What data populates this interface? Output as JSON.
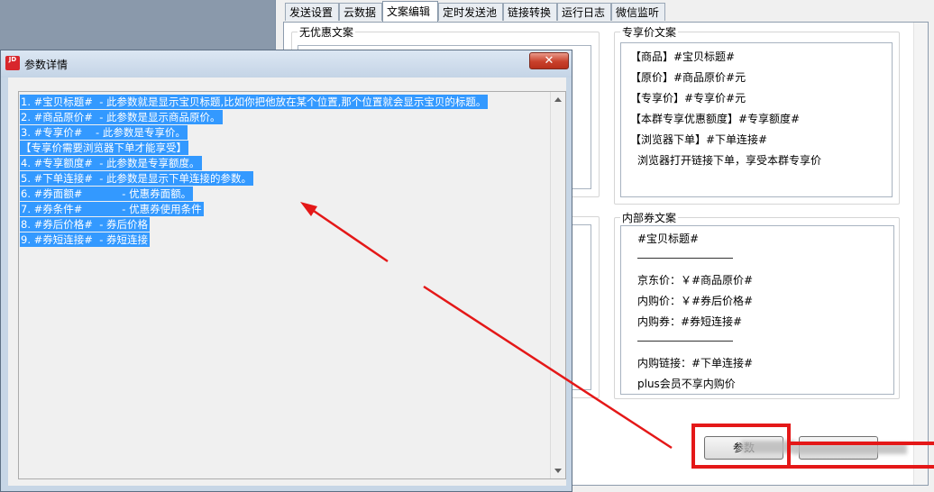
{
  "tabs": [
    "发送设置",
    "云数据",
    "文案编辑",
    "定时发送池",
    "链接转换",
    "运行日志",
    "微信监听"
  ],
  "active_tab": "文案编辑",
  "groups": {
    "no_discount": "无优惠文案",
    "exclusive": "专享价文案",
    "internal": "内部券文案"
  },
  "exclusive_lines": [
    "【商品】#宝贝标题#",
    "【原价】#商品原价#元",
    "【专享价】#专享价#元",
    "【本群专享优惠额度】#专享额度#",
    "【浏览器下单】#下单连接#",
    "浏览器打开链接下单，享受本群专享价"
  ],
  "internal_lines": [
    "#宝贝标题#",
    "京东价：￥#商品原价#",
    "内购价：￥#券后价格#",
    "内购券：#券短连接#",
    "内购链接：#下单连接#",
    "plus会员不享内购价"
  ],
  "buttons": {
    "params": "参数",
    "other": ""
  },
  "dialog": {
    "title": "参数详情",
    "app_icon": "JD",
    "close_label": "✕",
    "lines": [
      "1. #宝贝标题#  - 此参数就是显示宝贝标题,比如你把他放在某个位置,那个位置就会显示宝贝的标题。",
      "2. #商品原价#  - 此参数是显示商品原价。",
      "3. #专享价#    - 此参数是专享价。",
      "【专享价需要浏览器下单才能享受】",
      "4. #专享额度#  - 此参数是专享额度。",
      "5. #下单连接#  - 此参数是显示下单连接的参数。",
      "6. #券面额#            - 优惠券面额。",
      "7. #券条件#            - 优惠券使用条件",
      "8. #券后价格#  - 券后价格",
      "9. #券短连接#  - 券短连接"
    ]
  },
  "colors": {
    "selection": "#3399ff",
    "annotation": "#e41818",
    "close_button": "#c9412b"
  }
}
